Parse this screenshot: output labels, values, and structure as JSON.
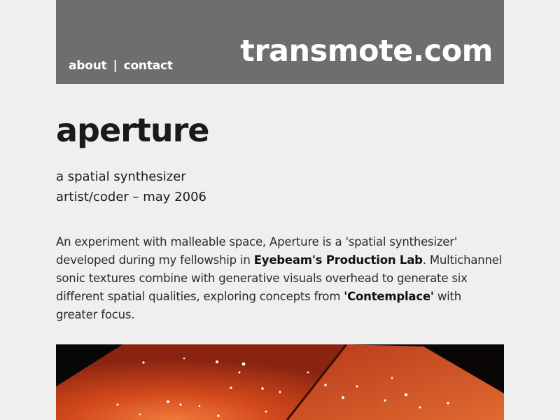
{
  "header": {
    "nav": [
      {
        "label": "about"
      },
      {
        "label": "contact"
      }
    ],
    "separator": "|",
    "logo": "transmote.com",
    "background": "#6e6e6e"
  },
  "project": {
    "title": "aperture",
    "subtitle": "a spatial synthesizer",
    "role_date": "artist/coder – may 2006",
    "description": {
      "p1": "An experiment with malleable space, Aperture is a 'spatial synthesizer' developed during my fellowship in ",
      "link1": "Eyebeam's Production Lab",
      "p2": ". Multichannel sonic textures combine with generative visuals overhead to generate six different spatial qualities, exploring concepts from ",
      "link2": "'Contemplace'",
      "p3": " with greater focus."
    }
  },
  "colors": {
    "page_bg": "#efefef",
    "text": "#1c1c1c",
    "hero_orange": "#c8401a"
  }
}
